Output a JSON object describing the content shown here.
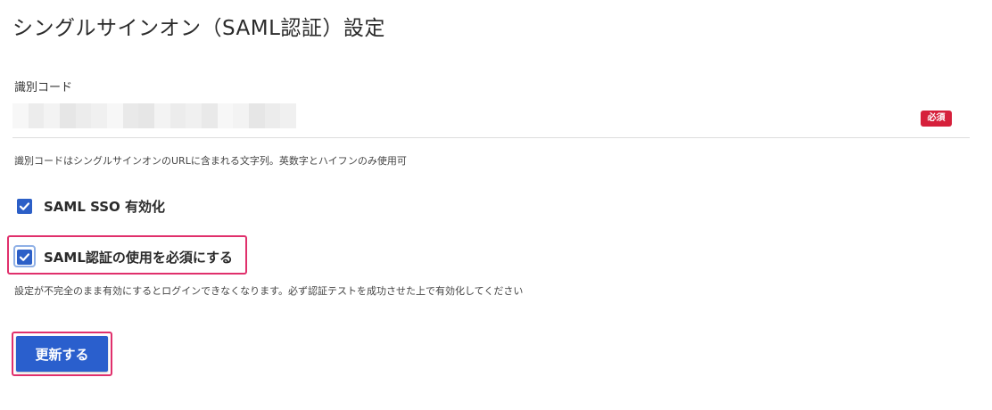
{
  "page": {
    "title": "シングルサインオン（SAML認証）設定"
  },
  "identifier_field": {
    "label": "識別コード",
    "required_badge": "必須",
    "value_redacted": true,
    "help": "識別コードはシングルサインオンのURLに含まれる文字列。英数字とハイフンのみ使用可"
  },
  "options": [
    {
      "label": "SAML SSO 有効化",
      "checked": true
    },
    {
      "label": "SAML認証の使用を必須にする",
      "checked": true
    }
  ],
  "options_help": "設定が不完全のまま有効にするとログインできなくなります。必ず認証テストを成功させた上で有効化してください",
  "submit": {
    "label": "更新する"
  },
  "colors": {
    "primary": "#2a5fcd",
    "checkbox": "#2c5fc7",
    "required_badge": "#d6203b",
    "highlight": "#e0306c",
    "redaction_shades": [
      "#f7f7f7",
      "#ececec",
      "#f3f3f3",
      "#e6e6e6",
      "#f0f0f0",
      "#e9e9e9"
    ]
  },
  "icons": {
    "checkbox": "checkmark-icon"
  }
}
